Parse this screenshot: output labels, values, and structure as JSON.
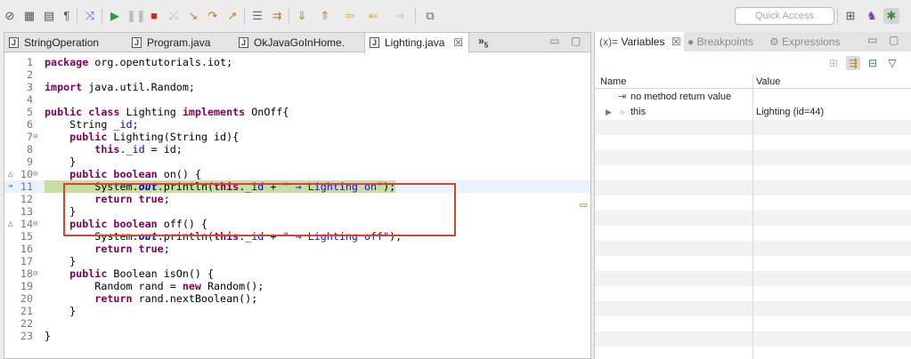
{
  "toolbar": {
    "quick_access_placeholder": "Quick Access",
    "buttons": [
      "skip-all-breakpoints-icon",
      "link-to-editor-icon",
      "pilcrow-icon",
      "use-step-filters-icon",
      "resume-icon",
      "suspend-icon",
      "terminate-icon",
      "disconnect-icon",
      "step-into-icon",
      "step-over-icon",
      "step-return-icon",
      "drop-to-frame-icon",
      "step-into-selection-icon",
      "next-annotation-icon",
      "previous-annotation-icon",
      "last-edit-icon",
      "back-icon",
      "forward-icon",
      "new-window-icon"
    ]
  },
  "editor": {
    "tabs": [
      {
        "label": "StringOperation"
      },
      {
        "label": "Program.java"
      },
      {
        "label": "OkJavaGoInHome."
      },
      {
        "label": "Lighting.java",
        "active": true
      }
    ],
    "overflow_label": "»",
    "overflow_count": "5",
    "code": [
      {
        "n": "1",
        "text": "package org.opentutorials.iot;"
      },
      {
        "n": "2",
        "text": ""
      },
      {
        "n": "3",
        "text": "import java.util.Random;"
      },
      {
        "n": "4",
        "text": ""
      },
      {
        "n": "5",
        "text": "public class Lighting implements OnOff{"
      },
      {
        "n": "6",
        "text": "    String _id;"
      },
      {
        "n": "7",
        "text": "    public Lighting(String id){"
      },
      {
        "n": "8",
        "text": "        this._id = id;"
      },
      {
        "n": "9",
        "text": "    }"
      },
      {
        "n": "10",
        "text": "    public boolean on() {"
      },
      {
        "n": "11",
        "text": "        System.out.println(this._id + \" → Lighting on\");"
      },
      {
        "n": "12",
        "text": "        return true;"
      },
      {
        "n": "13",
        "text": "    }"
      },
      {
        "n": "14",
        "text": "    public boolean off() {"
      },
      {
        "n": "15",
        "text": "        System.out.println(this._id + \" → Lighting off\");"
      },
      {
        "n": "16",
        "text": "        return true;"
      },
      {
        "n": "17",
        "text": "    }"
      },
      {
        "n": "18",
        "text": "    public Boolean isOn() {"
      },
      {
        "n": "19",
        "text": "        Random rand = new Random();"
      },
      {
        "n": "20",
        "text": "        return rand.nextBoolean();"
      },
      {
        "n": "21",
        "text": "    }"
      },
      {
        "n": "22",
        "text": ""
      },
      {
        "n": "23",
        "text": "}"
      }
    ]
  },
  "variables_panel": {
    "tabs": [
      {
        "label": "Variables",
        "prefix": "(x)="
      },
      {
        "label": "Breakpoints"
      },
      {
        "label": "Expressions"
      }
    ],
    "columns": [
      "Name",
      "Value"
    ],
    "rows": [
      {
        "name": "no method return value",
        "value": ""
      },
      {
        "name": "this",
        "value": "Lighting  (id=44)"
      }
    ]
  }
}
